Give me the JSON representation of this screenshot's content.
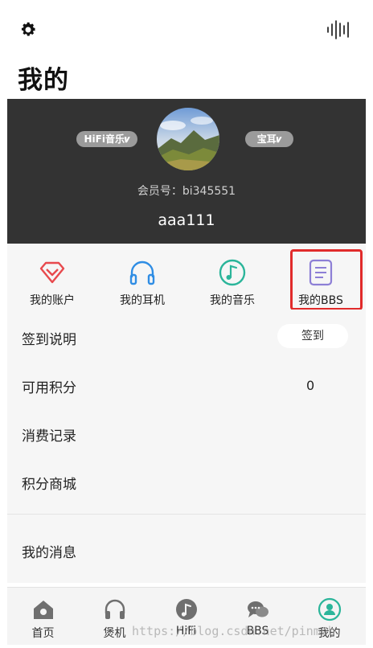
{
  "header": {
    "title": "我的",
    "settings_icon": "gear-icon",
    "audio_icon": "sound-wave-icon"
  },
  "profile": {
    "badge_left": "HiFi音乐𝒗",
    "badge_right": "宝耳𝒗",
    "member_label": "会员号：bi345551",
    "username": "aaa111"
  },
  "quick_links": [
    {
      "label": "我的账户",
      "icon": "diamond-icon",
      "color": "#e8494d"
    },
    {
      "label": "我的耳机",
      "icon": "headphones-icon",
      "color": "#2f8de4"
    },
    {
      "label": "我的音乐",
      "icon": "music-note-icon",
      "color": "#2bb59a"
    },
    {
      "label": "我的BBS",
      "icon": "document-icon",
      "color": "#8d7fd6"
    }
  ],
  "menu": {
    "checkin_label": "签到说明",
    "checkin_button": "签到",
    "points_label": "可用积分",
    "points_value": "0",
    "history_label": "消费记录",
    "store_label": "积分商城",
    "messages_label": "我的消息"
  },
  "tabs": [
    {
      "label": "首页",
      "icon": "home-icon"
    },
    {
      "label": "煲机",
      "icon": "headphones-icon"
    },
    {
      "label": "HiFi",
      "icon": "music-note-icon"
    },
    {
      "label": "BBS",
      "icon": "chat-icon"
    },
    {
      "label": "我的",
      "icon": "user-icon",
      "active": true
    }
  ],
  "watermark": "https://blog.csdn.net/pinmob",
  "colors": {
    "profile_bg": "#333333",
    "highlight_border": "#e12b2b",
    "active_tab": "#2bb59a"
  }
}
